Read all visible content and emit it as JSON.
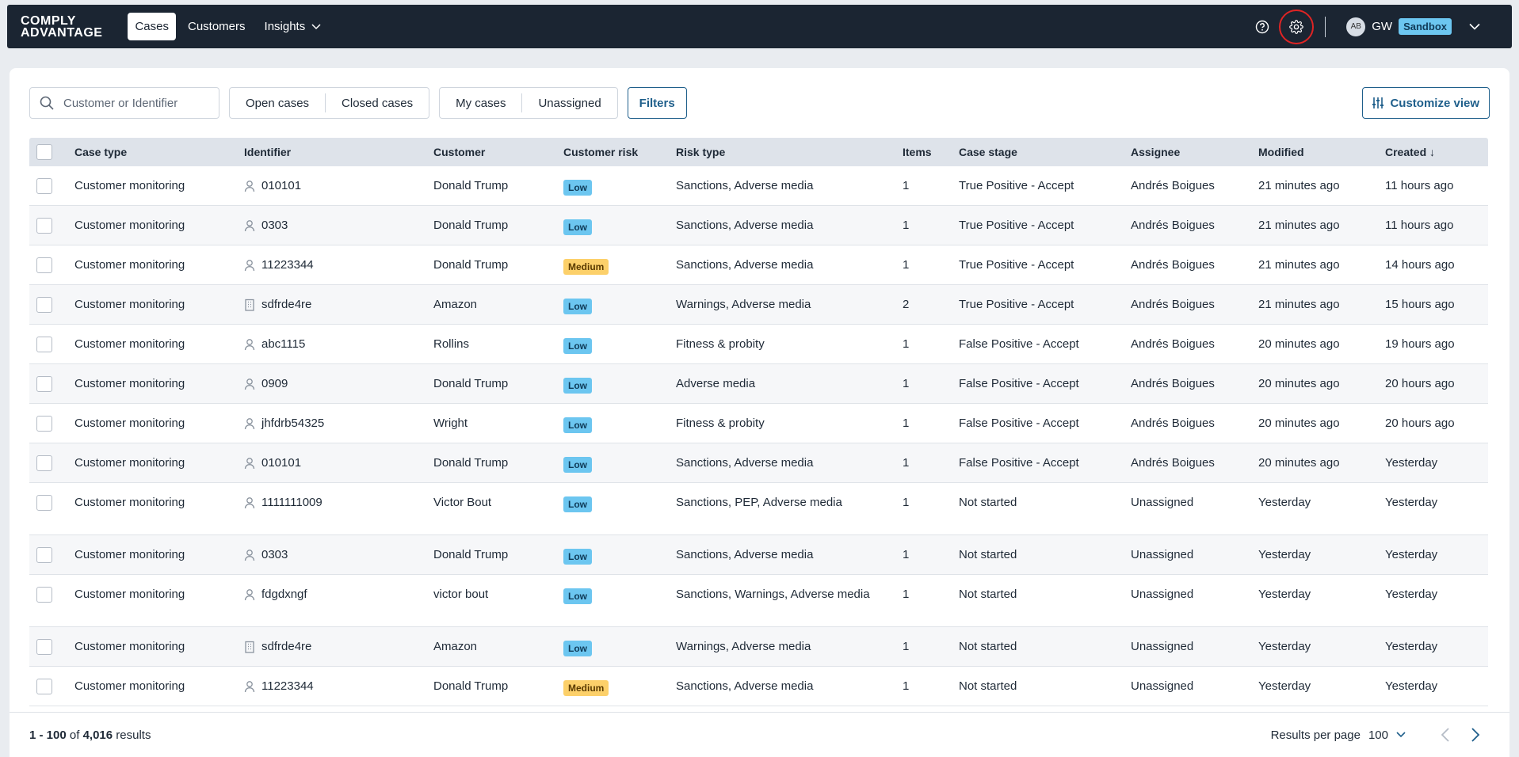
{
  "app": {
    "logo_line1": "COMPLY",
    "logo_line2": "ADVANTAGE",
    "nav": [
      {
        "label": "Cases",
        "active": true
      },
      {
        "label": "Customers",
        "active": false
      },
      {
        "label": "Insights",
        "active": false
      }
    ],
    "help_icon": "help-circle-icon",
    "settings_icon": "gear-icon",
    "user": {
      "avatar": "AB",
      "initials": "GW",
      "environment": "Sandbox"
    }
  },
  "toolbar": {
    "search_placeholder": "Customer or Identifier",
    "case_status": [
      "Open cases",
      "Closed cases"
    ],
    "assignment": [
      "My cases",
      "Unassigned"
    ],
    "filters_label": "Filters",
    "customize_label": "Customize view"
  },
  "table": {
    "columns": [
      "Case type",
      "Identifier",
      "Customer",
      "Customer risk",
      "Risk type",
      "Items",
      "Case stage",
      "Assignee",
      "Modified",
      "Created"
    ],
    "sort_indicator": "↓",
    "rows": [
      {
        "case_type": "Customer monitoring",
        "id_kind": "person",
        "identifier": "010101",
        "customer": "Donald Trump",
        "risk": "Low",
        "risk_type": "Sanctions, Adverse media",
        "items": "1",
        "stage": "True Positive - Accept",
        "assignee": "Andrés Boigues",
        "modified": "21 minutes ago",
        "created": "11 hours ago"
      },
      {
        "case_type": "Customer monitoring",
        "id_kind": "person",
        "identifier": "0303",
        "customer": "Donald Trump",
        "risk": "Low",
        "risk_type": "Sanctions, Adverse media",
        "items": "1",
        "stage": "True Positive - Accept",
        "assignee": "Andrés Boigues",
        "modified": "21 minutes ago",
        "created": "11 hours ago"
      },
      {
        "case_type": "Customer monitoring",
        "id_kind": "person",
        "identifier": "11223344",
        "customer": "Donald Trump",
        "risk": "Medium",
        "risk_type": "Sanctions, Adverse media",
        "items": "1",
        "stage": "True Positive - Accept",
        "assignee": "Andrés Boigues",
        "modified": "21 minutes ago",
        "created": "14 hours ago"
      },
      {
        "case_type": "Customer monitoring",
        "id_kind": "company",
        "identifier": "sdfrde4re",
        "customer": "Amazon",
        "risk": "Low",
        "risk_type": "Warnings, Adverse media",
        "items": "2",
        "stage": "True Positive - Accept",
        "assignee": "Andrés Boigues",
        "modified": "21 minutes ago",
        "created": "15 hours ago"
      },
      {
        "case_type": "Customer monitoring",
        "id_kind": "person",
        "identifier": "abc1115",
        "customer": "Rollins",
        "risk": "Low",
        "risk_type": "Fitness & probity",
        "items": "1",
        "stage": "False Positive - Accept",
        "assignee": "Andrés Boigues",
        "modified": "20 minutes ago",
        "created": "19 hours ago"
      },
      {
        "case_type": "Customer monitoring",
        "id_kind": "person",
        "identifier": "0909",
        "customer": "Donald Trump",
        "risk": "Low",
        "risk_type": "Adverse media",
        "items": "1",
        "stage": "False Positive - Accept",
        "assignee": "Andrés Boigues",
        "modified": "20 minutes ago",
        "created": "20 hours ago"
      },
      {
        "case_type": "Customer monitoring",
        "id_kind": "person",
        "identifier": "jhfdrb54325",
        "customer": "Wright",
        "risk": "Low",
        "risk_type": "Fitness & probity",
        "items": "1",
        "stage": "False Positive - Accept",
        "assignee": "Andrés Boigues",
        "modified": "20 minutes ago",
        "created": "20 hours ago"
      },
      {
        "case_type": "Customer monitoring",
        "id_kind": "person",
        "identifier": "010101",
        "customer": "Donald Trump",
        "risk": "Low",
        "risk_type": "Sanctions, Adverse media",
        "items": "1",
        "stage": "False Positive - Accept",
        "assignee": "Andrés Boigues",
        "modified": "20 minutes ago",
        "created": "Yesterday"
      },
      {
        "case_type": "Customer monitoring",
        "id_kind": "person",
        "identifier": "1111111009",
        "customer": "Victor Bout",
        "risk": "Low",
        "risk_type": "Sanctions, PEP, Adverse media",
        "items": "1",
        "stage": "Not started",
        "assignee": "Unassigned",
        "modified": "Yesterday",
        "created": "Yesterday"
      },
      {
        "case_type": "Customer monitoring",
        "id_kind": "person",
        "identifier": "0303",
        "customer": "Donald Trump",
        "risk": "Low",
        "risk_type": "Sanctions, Adverse media",
        "items": "1",
        "stage": "Not started",
        "assignee": "Unassigned",
        "modified": "Yesterday",
        "created": "Yesterday"
      },
      {
        "case_type": "Customer monitoring",
        "id_kind": "person",
        "identifier": "fdgdxngf",
        "customer": "victor bout",
        "risk": "Low",
        "risk_type": "Sanctions, Warnings, Adverse media",
        "items": "1",
        "stage": "Not started",
        "assignee": "Unassigned",
        "modified": "Yesterday",
        "created": "Yesterday"
      },
      {
        "case_type": "Customer monitoring",
        "id_kind": "company",
        "identifier": "sdfrde4re",
        "customer": "Amazon",
        "risk": "Low",
        "risk_type": "Warnings, Adverse media",
        "items": "1",
        "stage": "Not started",
        "assignee": "Unassigned",
        "modified": "Yesterday",
        "created": "Yesterday"
      },
      {
        "case_type": "Customer monitoring",
        "id_kind": "person",
        "identifier": "11223344",
        "customer": "Donald Trump",
        "risk": "Medium",
        "risk_type": "Sanctions, Adverse media",
        "items": "1",
        "stage": "Not started",
        "assignee": "Unassigned",
        "modified": "Yesterday",
        "created": "Yesterday"
      }
    ]
  },
  "footer": {
    "range": "1 - 100",
    "of": "of",
    "total": "4,016",
    "results": "results",
    "rpp_label": "Results per page",
    "rpp_value": "100"
  },
  "colors": {
    "nav_bg": "#1b2532",
    "accent": "#1f5f8b",
    "low": "#6cc6f0",
    "medium": "#fcd06a",
    "settings_highlight": "#e02424"
  }
}
